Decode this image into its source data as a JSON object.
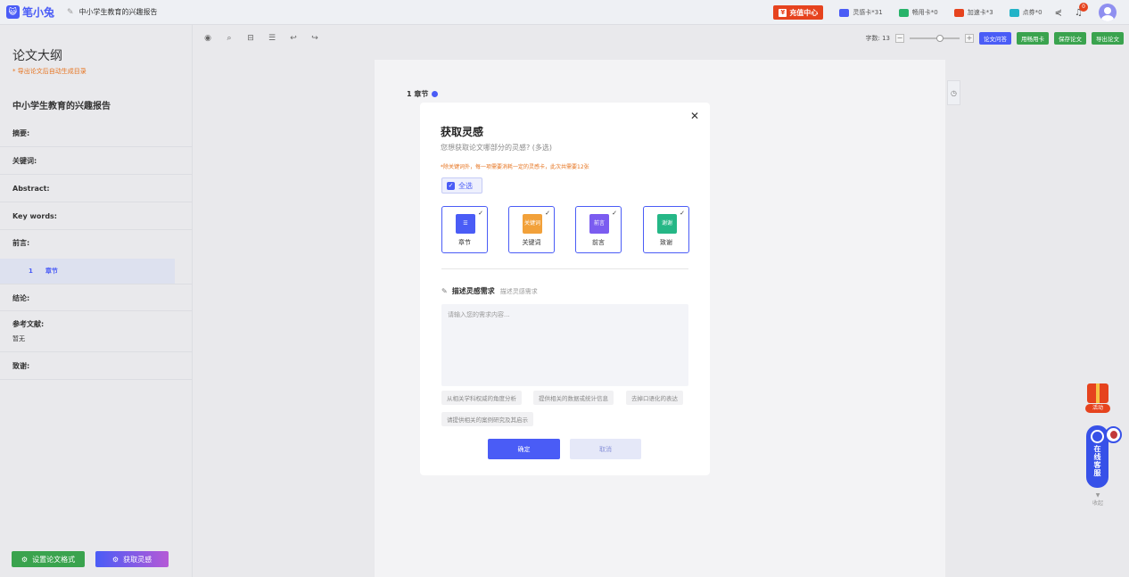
{
  "app": {
    "logo_glyph": "😺",
    "logo_text": "笔小兔",
    "doc_title": "中小学生教育的兴趣报告"
  },
  "top": {
    "recharge": "充值中心",
    "cards": [
      {
        "label": "灵感卡*31",
        "color": "#4a5cf6"
      },
      {
        "label": "畅用卡*0",
        "color": "#28b36a"
      },
      {
        "label": "加速卡*3",
        "color": "#e6431e"
      },
      {
        "label": "点券*0",
        "color": "#22b3c8"
      }
    ],
    "notif_count": "0"
  },
  "sidebar": {
    "title": "论文大纲",
    "note": "* 导出论文后自动生成目录",
    "doc_name": "中小学生教育的兴趣报告",
    "items": [
      {
        "label": "摘要:"
      },
      {
        "label": "关键词:"
      },
      {
        "label": "Abstract:"
      },
      {
        "label": "Key words:"
      },
      {
        "label": "前言:"
      },
      {
        "label": "结论:"
      },
      {
        "label": "参考文献:",
        "sub": "暂无"
      },
      {
        "label": "致谢:"
      }
    ],
    "chapter_num": "1",
    "chapter_label": "章节",
    "btn_format": "设置论文格式",
    "btn_inspire": "获取灵感"
  },
  "toolbar": {
    "word_count": "字数: 13",
    "btn_qa": "论文问答",
    "btn_card": "用畅用卡",
    "btn_save": "保存论文",
    "btn_export": "导出论文"
  },
  "editor": {
    "chapter": "1 章节"
  },
  "modal": {
    "title": "获取灵感",
    "subtitle": "您想获取论文哪部分的灵感? (多选)",
    "warning": "*除关键词外，每一项需要消耗一定的灵感卡，此次共需要12张",
    "select_all": "全选",
    "options": [
      {
        "label": "章节",
        "color": "#4a5cf6"
      },
      {
        "label": "关键词",
        "color": "#f2a13a",
        "icon_text": "关键词"
      },
      {
        "label": "前言",
        "color": "#7b5cf0",
        "icon_text": "前言"
      },
      {
        "label": "致谢",
        "color": "#25b786",
        "icon_text": "谢谢"
      }
    ],
    "desc_title": "描述灵感需求",
    "desc_hint": "描述灵感需求",
    "placeholder": "请输入您的需求内容...",
    "chips": [
      "从相关学科权威的角度分析",
      "提供相关的数据或统计信息",
      "去掉口语化的表达",
      "请提供相关的案例研究及其启示"
    ],
    "ok": "确定",
    "cancel": "取消"
  },
  "side_widgets": {
    "activity": "活动",
    "service": "在线客服",
    "collapse": "收起"
  }
}
